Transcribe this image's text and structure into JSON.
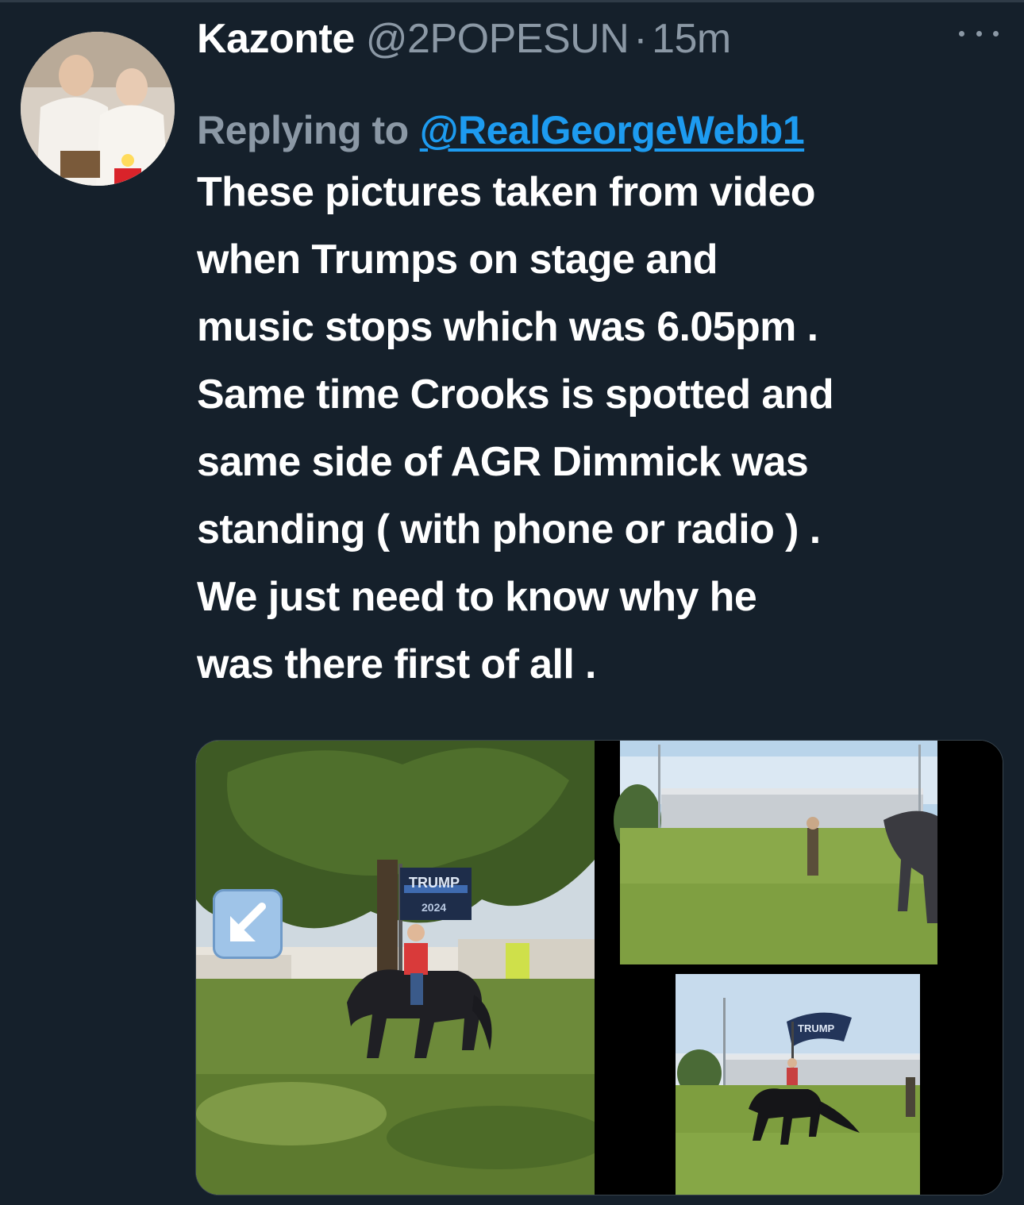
{
  "tweet": {
    "display_name": "Kazonte",
    "handle": "@2POPESUN",
    "separator": "·",
    "timestamp": "15m",
    "replying_to_label": "Replying to",
    "replying_to_handle": "@RealGeorgeWebb1",
    "body_lines": [
      "These pictures taken from video",
      "when Trumps on stage and",
      "music stops which was 6.05pm .",
      "Same time Crooks is spotted and",
      "same side of AGR Dimmick was",
      "standing ( with phone or radio )  .",
      "We just need to know why he",
      "was there first of all ."
    ]
  },
  "media": {
    "flag_text_top": "TRUMP",
    "flag_text_bottom": "2024",
    "flag_text_small": "TRUMP"
  },
  "icons": {
    "more": "more-horizontal-icon",
    "expand": "arrow-down-left-icon"
  },
  "colors": {
    "background": "#15202b",
    "muted_text": "#8b98a5",
    "link": "#1d9bf0"
  }
}
